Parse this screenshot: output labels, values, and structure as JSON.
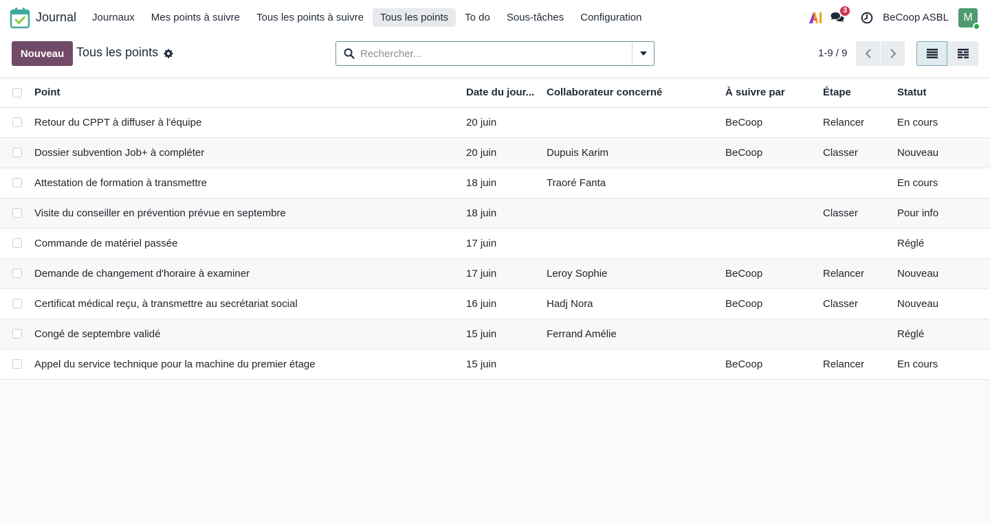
{
  "app": {
    "name": "Journal",
    "brand_color": "#714b67"
  },
  "nav": {
    "items": [
      {
        "label": "Journaux",
        "active": false
      },
      {
        "label": "Mes points à suivre",
        "active": false
      },
      {
        "label": "Tous les points à suivre",
        "active": false
      },
      {
        "label": "Tous les points",
        "active": true
      },
      {
        "label": "To do",
        "active": false
      },
      {
        "label": "Sous-tâches",
        "active": false
      },
      {
        "label": "Configuration",
        "active": false
      }
    ],
    "messages_badge": "3",
    "company": "BeCoop ASBL",
    "avatar_letter": "M"
  },
  "control": {
    "new_button": "Nouveau",
    "title": "Tous les points",
    "search_placeholder": "Rechercher...",
    "pager": "1-9 / 9"
  },
  "table": {
    "headers": {
      "point": "Point",
      "date": "Date du jour...",
      "collab": "Collaborateur concerné",
      "suivi": "À suivre par",
      "etape": "Étape",
      "statut": "Statut"
    },
    "rows": [
      {
        "point": "Retour du CPPT à diffuser à l'équipe",
        "date": "20 juin",
        "collab": "",
        "suivi": "BeCoop",
        "etape": "Relancer",
        "statut": "En cours"
      },
      {
        "point": "Dossier subvention Job+ à compléter",
        "date": "20 juin",
        "collab": "Dupuis Karim",
        "suivi": "BeCoop",
        "etape": "Classer",
        "statut": "Nouveau"
      },
      {
        "point": "Attestation de formation à transmettre",
        "date": "18 juin",
        "collab": "Traoré Fanta",
        "suivi": "",
        "etape": "",
        "statut": "En cours"
      },
      {
        "point": "Visite du conseiller en prévention prévue en septembre",
        "date": "18 juin",
        "collab": "",
        "suivi": "",
        "etape": "Classer",
        "statut": "Pour info"
      },
      {
        "point": "Commande de matériel passée",
        "date": "17 juin",
        "collab": "",
        "suivi": "",
        "etape": "",
        "statut": "Réglé"
      },
      {
        "point": "Demande de changement d'horaire à examiner",
        "date": "17 juin",
        "collab": "Leroy Sophie",
        "suivi": "BeCoop",
        "etape": "Relancer",
        "statut": "Nouveau"
      },
      {
        "point": "Certificat médical reçu, à transmettre au secrétariat social",
        "date": "16 juin",
        "collab": "Hadj Nora",
        "suivi": "BeCoop",
        "etape": "Classer",
        "statut": "Nouveau"
      },
      {
        "point": "Congé de septembre validé",
        "date": "15 juin",
        "collab": "Ferrand Amélie",
        "suivi": "",
        "etape": "",
        "statut": "Réglé"
      },
      {
        "point": "Appel du service technique pour la machine du premier étage",
        "date": "15 juin",
        "collab": "",
        "suivi": "BeCoop",
        "etape": "Relancer",
        "statut": "En cours"
      }
    ]
  }
}
